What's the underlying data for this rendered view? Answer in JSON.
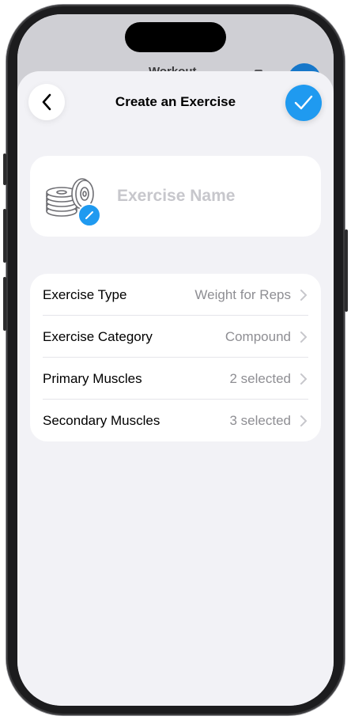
{
  "background_app": {
    "title": "Workout"
  },
  "nav": {
    "title": "Create an Exercise",
    "back_icon": "chevron-left-icon",
    "confirm_icon": "checkmark-icon"
  },
  "exercise_name": {
    "placeholder": "Exercise Name",
    "value": "",
    "image_icon": "weight-plates-icon",
    "edit_icon": "pencil-icon"
  },
  "settings": [
    {
      "label": "Exercise Type",
      "value": "Weight for Reps"
    },
    {
      "label": "Exercise Category",
      "value": "Compound"
    },
    {
      "label": "Primary Muscles",
      "value": "2 selected"
    },
    {
      "label": "Secondary Muscles",
      "value": "3 selected"
    }
  ],
  "colors": {
    "accent": "#1f9af0",
    "sheet_background": "#f2f2f6",
    "card_background": "#ffffff",
    "secondary_text": "#8e8e93",
    "placeholder_text": "#c7c7cc"
  }
}
